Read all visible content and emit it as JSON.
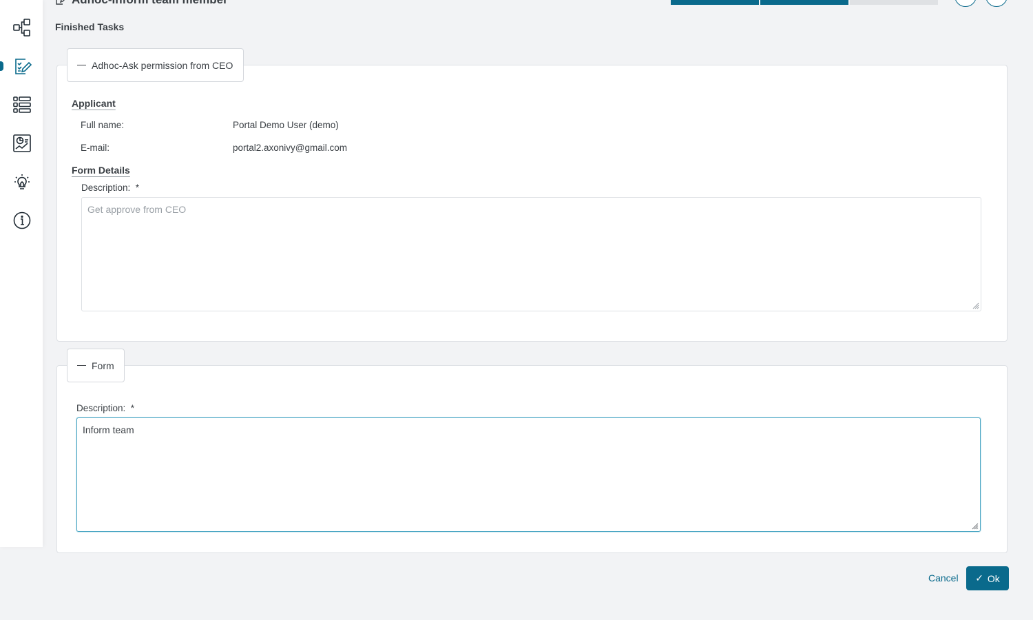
{
  "header": {
    "title": "Adhoc-Inform team member",
    "progress_colors": [
      "#0a6a8c",
      "#0a6a8c",
      "#dfe1e4"
    ]
  },
  "sidebar": {
    "items": [
      {
        "icon": "process-icon"
      },
      {
        "icon": "task-list-icon"
      },
      {
        "icon": "case-list-icon"
      },
      {
        "icon": "statistics-icon"
      },
      {
        "icon": "idea-icon"
      },
      {
        "icon": "info-icon"
      }
    ]
  },
  "page": {
    "finished_tasks": "Finished Tasks"
  },
  "panel1": {
    "legend": "Adhoc-Ask permission from CEO",
    "applicant_heading": "Applicant",
    "full_name_label": "Full name:",
    "full_name_value": "Portal Demo User (demo)",
    "email_label": "E-mail:",
    "email_value": "portal2.axonivy@gmail.com",
    "form_details_heading": "Form Details",
    "description_label": "Description:  *",
    "description_value": "Get approve from CEO"
  },
  "panel2": {
    "legend": "Form",
    "description_label": "Description:  *",
    "description_value": "Inform team"
  },
  "actions": {
    "cancel_label": "Cancel",
    "ok_label": "Ok",
    "ok_icon": "✓"
  },
  "colors": {
    "accent": "#0a6a8c",
    "focus": "#4aa6c4",
    "background": "#f2f3f5"
  }
}
